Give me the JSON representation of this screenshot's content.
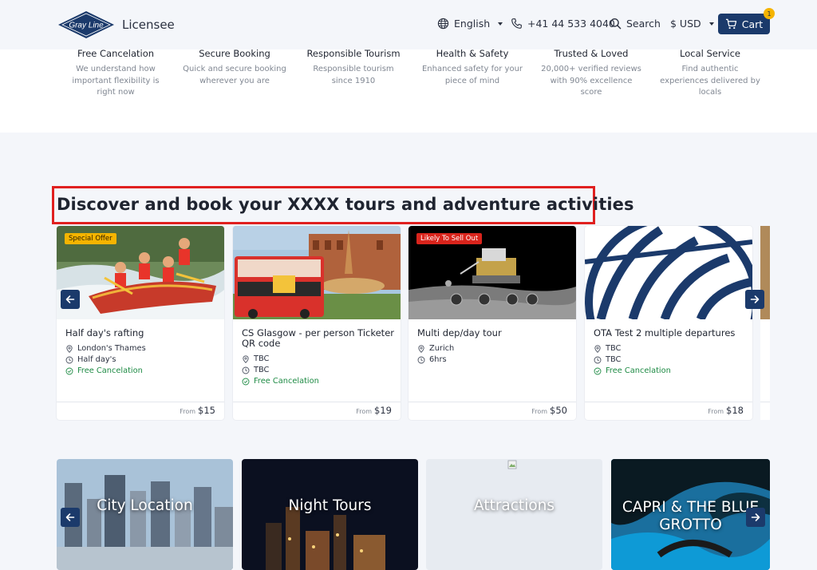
{
  "header": {
    "logo_text": "Gray Line",
    "brand_suffix": "Licensee",
    "language": "English",
    "phone": "+41 44 533 4040",
    "search": "Search",
    "currency": "$ USD",
    "cart_label": "Cart",
    "cart_count": "1",
    "colors": {
      "primary": "#1b3a6b",
      "badge": "#f5b400"
    }
  },
  "features": [
    {
      "title": "Free Cancelation",
      "desc": "We understand how important flexibility is right now"
    },
    {
      "title": "Secure Booking",
      "desc": "Quick and secure booking wherever you are"
    },
    {
      "title": "Responsible Tourism",
      "desc": "Responsible tourism since 1910"
    },
    {
      "title": "Health & Safety",
      "desc": "Enhanced safety for your piece of mind"
    },
    {
      "title": "Trusted & Loved",
      "desc": "20,000+ verified reviews with 90% excellence score"
    },
    {
      "title": "Local Service",
      "desc": "Find authentic experiences delivered by locals"
    }
  ],
  "section": {
    "heading": "Discover and book your XXXX tours and adventure activities",
    "highlight_color": "#e0201f"
  },
  "tours": [
    {
      "badge": "Special Offer",
      "title": "Half day's rafting",
      "location": "London's Thames",
      "duration": "Half day's",
      "free_cancel": "Free Cancelation",
      "from": "From",
      "price": "$15"
    },
    {
      "badge": "",
      "title": "CS Glasgow - per person Ticketer QR code",
      "location": "TBC",
      "duration": "TBC",
      "free_cancel": "Free Cancelation",
      "from": "From",
      "price": "$19"
    },
    {
      "badge": "Likely To Sell Out",
      "title": "Multi dep/day tour",
      "location": "Zurich",
      "duration": "6hrs",
      "free_cancel": "",
      "from": "From",
      "price": "$50"
    },
    {
      "badge": "",
      "title": "OTA Test 2 multiple departures",
      "location": "TBC",
      "duration": "TBC",
      "free_cancel": "Free Cancelation",
      "from": "From",
      "price": "$18"
    }
  ],
  "categories": [
    {
      "label": "City Location"
    },
    {
      "label": "Night Tours"
    },
    {
      "label": "Attractions"
    },
    {
      "label": "CAPRI & THE BLUE GROTTO"
    }
  ],
  "icons": {
    "globe": "globe-icon",
    "phone": "phone-icon",
    "search": "search-icon",
    "cart": "cart-icon",
    "location": "location-pin-icon",
    "clock": "clock-icon",
    "check": "check-circle-icon",
    "prev": "arrow-left-icon",
    "next": "arrow-right-icon"
  }
}
